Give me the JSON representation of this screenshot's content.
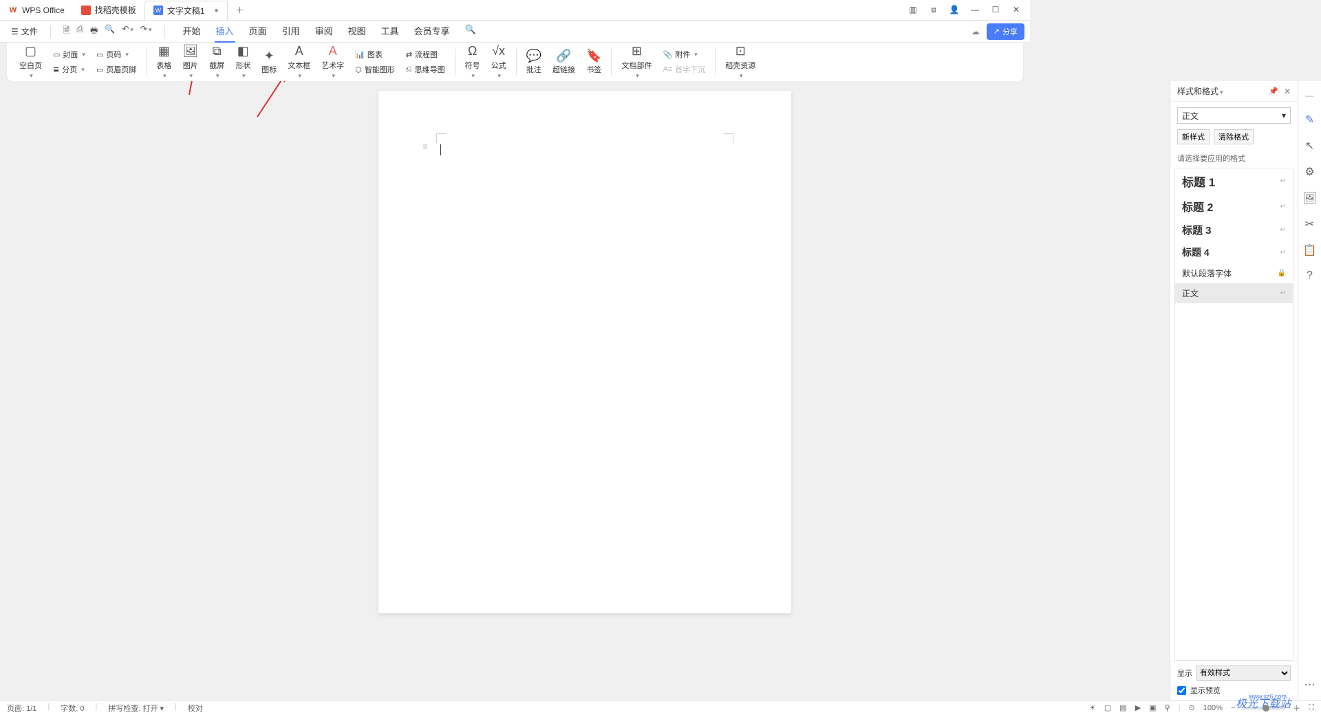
{
  "titlebar": {
    "app": "WPS Office",
    "tabs": [
      {
        "label": "找稻壳模板"
      },
      {
        "label": "文字文稿1",
        "active": true,
        "modified": "●"
      }
    ]
  },
  "menu": {
    "file": "文件",
    "items": [
      "开始",
      "插入",
      "页面",
      "引用",
      "审阅",
      "视图",
      "工具",
      "会员专享"
    ],
    "active": "插入",
    "share": "分享"
  },
  "ribbon": {
    "blank": "空白页",
    "cover": "封面",
    "pagenum": "页码",
    "section": "分页",
    "headerfooter": "页眉页脚",
    "table": "表格",
    "picture": "图片",
    "screenshot": "截屏",
    "shapes": "形状",
    "icons": "图标",
    "textbox": "文本框",
    "wordart": "艺术字",
    "smartgraphic": "智能图形",
    "mindmap": "思维导图",
    "chart": "图表",
    "flowchart": "流程图",
    "symbol": "符号",
    "equation": "公式",
    "comment": "批注",
    "hyperlink": "超链接",
    "bookmark": "书签",
    "docparts": "文档部件",
    "dropcap": "首字下沉",
    "attachment": "附件",
    "resources": "稻壳资源"
  },
  "sidepanel": {
    "title": "样式和格式",
    "current": "正文",
    "newstyle": "新样式",
    "clear": "清除格式",
    "hint": "请选择要应用的格式",
    "styles": [
      {
        "label": "标题 1",
        "cls": "h1s"
      },
      {
        "label": "标题 2",
        "cls": "h2s"
      },
      {
        "label": "标题 3",
        "cls": "h3s"
      },
      {
        "label": "标题 4",
        "cls": "h4s"
      },
      {
        "label": "默认段落字体",
        "cls": "defpara",
        "lock": true
      },
      {
        "label": "正文",
        "cls": "bodys",
        "sel": true
      }
    ],
    "show": "显示",
    "showval": "有效样式",
    "preview": "显示预览"
  },
  "statusbar": {
    "page": "页面: 1/1",
    "words": "字数: 0",
    "spell": "拼写检查: 打开",
    "proof": "校对",
    "zoom": "100%"
  },
  "watermark": "极光下载站",
  "watermarkurl": "www.xz6.com"
}
